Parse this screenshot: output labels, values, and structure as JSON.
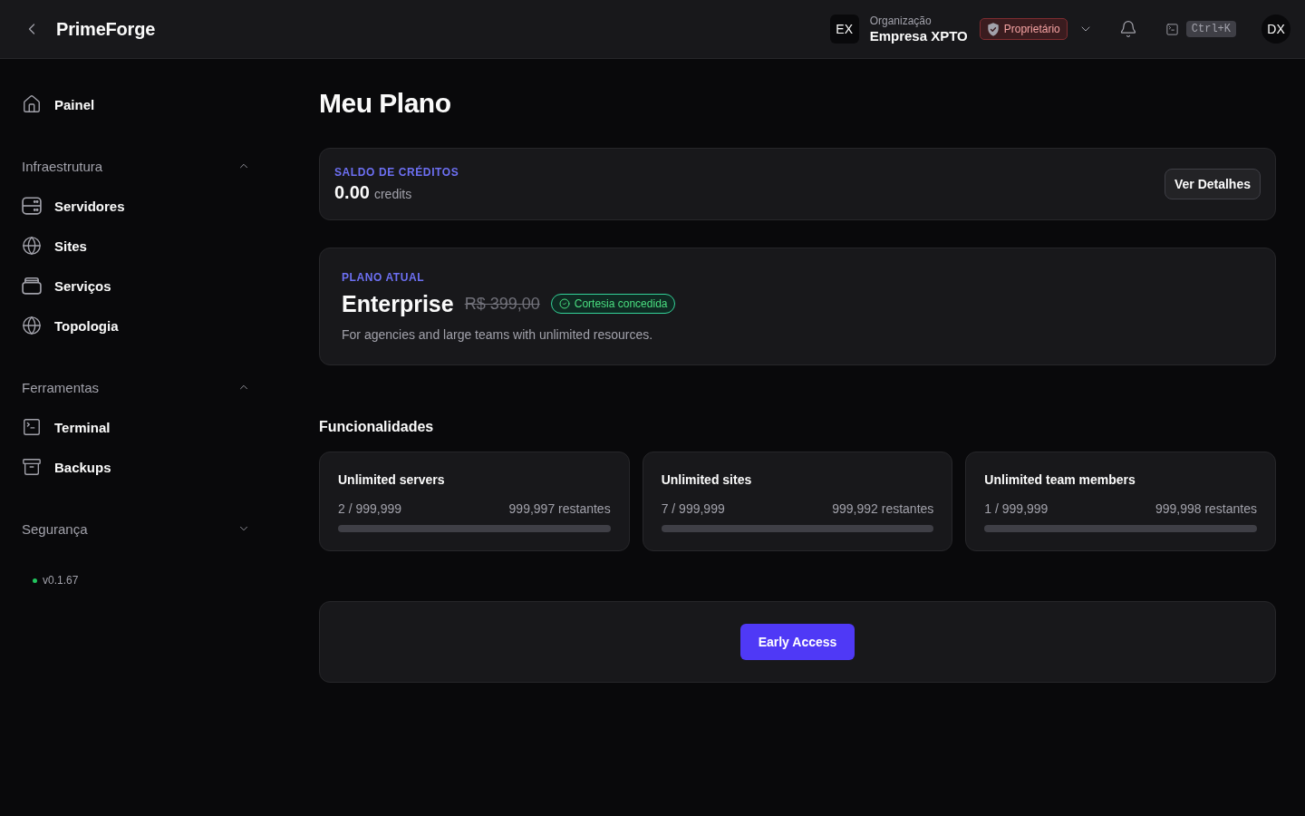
{
  "header": {
    "brand": "PrimeForge",
    "organization": {
      "initials": "EX",
      "label": "Organização",
      "name": "Empresa XPTO",
      "role": "Proprietário"
    },
    "shortcut": "Ctrl+K",
    "user_initials": "DX"
  },
  "sidebar": {
    "top_items": [
      {
        "label": "Painel",
        "selected": false
      }
    ],
    "sections": [
      {
        "title": "Infraestrutura",
        "expanded": true,
        "items": [
          {
            "label": "Servidores",
            "selected": false
          },
          {
            "label": "Sites",
            "selected": false
          },
          {
            "label": "Serviços",
            "selected": false
          },
          {
            "label": "Topologia",
            "selected": false
          }
        ]
      },
      {
        "title": "Ferramentas",
        "expanded": true,
        "items": [
          {
            "label": "Terminal",
            "selected": false
          },
          {
            "label": "Backups",
            "selected": false
          }
        ]
      },
      {
        "title": "Segurança",
        "expanded": false
      }
    ],
    "version": "v0.1.67"
  },
  "main": {
    "title": "Meu Plano",
    "credits": {
      "label": "SALDO DE CRÉDITOS",
      "amount": "0.00",
      "unit": "credits",
      "button": "Ver Detalhes"
    },
    "plan": {
      "label": "PLANO ATUAL",
      "name": "Enterprise",
      "original_price": "R$ 399,00",
      "badge": "Cortesia concedida",
      "description": "For agencies and large teams with unlimited resources."
    },
    "features": {
      "title": "Funcionalidades",
      "items": [
        {
          "title": "Unlimited servers",
          "usage": "2 / 999,999",
          "remaining": "999,997 restantes",
          "level": 0
        },
        {
          "title": "Unlimited sites",
          "usage": "7 / 999,999",
          "remaining": "999,992 restantes",
          "level": 0
        },
        {
          "title": "Unlimited team members",
          "usage": "1 / 999,999",
          "remaining": "999,998 restantes",
          "level": 0
        }
      ]
    },
    "early_access": {
      "button": "Early Access"
    }
  }
}
